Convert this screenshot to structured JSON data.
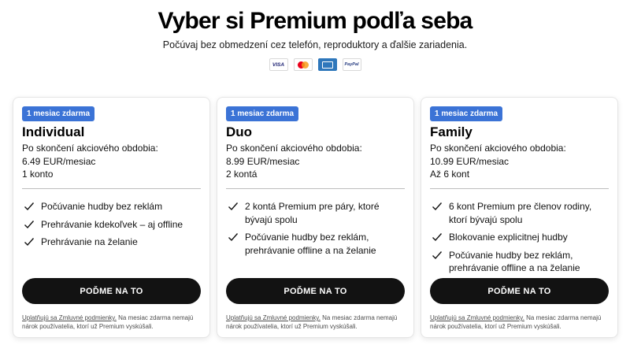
{
  "header": {
    "title": "Vyber si Premium podľa seba",
    "subtitle": "Počúvaj bez obmedzení cez telefón, reproduktory a ďalšie zariadenia."
  },
  "payment_methods": [
    {
      "name": "visa",
      "label": "VISA"
    },
    {
      "name": "mastercard",
      "label": ""
    },
    {
      "name": "amex",
      "label": ""
    },
    {
      "name": "paypal",
      "label": "PayPal"
    }
  ],
  "plans": [
    {
      "badge": "1 mesiac zdarma",
      "name": "Individual",
      "after_promo": "Po skončení akciového obdobia:",
      "price": "6.49 EUR/mesiac",
      "accounts": "1 konto",
      "features": [
        "Počúvanie hudby bez reklám",
        "Prehrávanie kdekoľvek – aj offline",
        "Prehrávanie na želanie"
      ],
      "cta": "POĎME NA TO",
      "terms_link": "Uplatňujú sa Zmluvné podmienky.",
      "terms_text": " Na mesiac zdarma nemajú nárok používatelia, ktorí už Premium vyskúšali."
    },
    {
      "badge": "1 mesiac zdarma",
      "name": "Duo",
      "after_promo": "Po skončení akciového obdobia:",
      "price": "8.99 EUR/mesiac",
      "accounts": "2 kontá",
      "features": [
        "2 kontá Premium pre páry, ktoré bývajú spolu",
        "Počúvanie hudby bez reklám, prehrávanie offline a na želanie"
      ],
      "cta": "POĎME NA TO",
      "terms_link": "Uplatňujú sa Zmluvné podmienky.",
      "terms_text": " Na mesiac zdarma nemajú nárok používatelia, ktorí už Premium vyskúšali."
    },
    {
      "badge": "1 mesiac zdarma",
      "name": "Family",
      "after_promo": "Po skončení akciového obdobia:",
      "price": "10.99 EUR/mesiac",
      "accounts": "Až 6 kont",
      "features": [
        "6 kont Premium pre členov rodiny, ktorí bývajú spolu",
        "Blokovanie explicitnej hudby",
        "Počúvanie hudby bez reklám, prehrávanie offline a na želanie"
      ],
      "cta": "POĎME NA TO",
      "terms_link": "Uplatňujú sa Zmluvné podmienky.",
      "terms_text": " Na mesiac zdarma nemajú nárok používatelia, ktorí už Premium vyskúšali."
    }
  ],
  "colors": {
    "badge": "#3b73d6",
    "cta": "#121212",
    "text": "#000000"
  }
}
